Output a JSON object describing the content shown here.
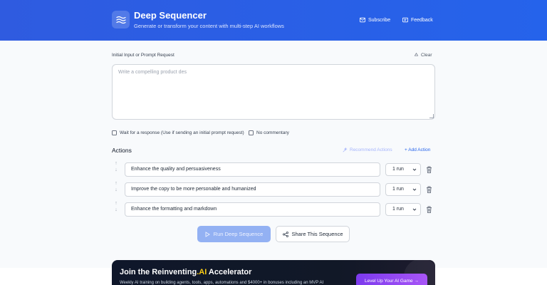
{
  "header": {
    "title": "Deep Sequencer",
    "subtitle": "Generate or transform your content with multi-step AI workflows",
    "subscribe_label": "Subscribe",
    "feedback_label": "Feedback",
    "logo_icon": "waves-icon"
  },
  "prompt": {
    "label": "Initial Input or Prompt Request",
    "clear_label": "Clear",
    "placeholder": "Write a compelling product des"
  },
  "options": {
    "wait_label": "Wait for a response (Use if sending an initial prompt request)",
    "no_commentary_label": "No commentary"
  },
  "actions": {
    "title": "Actions",
    "recommend_label": "Recommend Actions",
    "add_label": "+ Add Action",
    "items": [
      {
        "text": "Enhance the quality and persuasiveness",
        "runs": "1 run"
      },
      {
        "text": "Improve the copy to be more personable and humanized",
        "runs": "1 run"
      },
      {
        "text": "Enhance the formatting and markdown",
        "runs": "1 run"
      }
    ]
  },
  "buttons": {
    "run_label": "Run Deep Sequence",
    "share_label": "Share This Sequence"
  },
  "promo": {
    "title_prefix": "Join the Reinventing",
    "title_accent": ".AI",
    "title_suffix": " Accelerator",
    "subtitle": "Weekly AI training on building agents, tools, apps, automations and $4000+ in bonuses including an MVP AI",
    "button_label": "Level Up Your AI Game →"
  },
  "colors": {
    "header": "#2563eb",
    "accent": "#2563eb",
    "promo_bg": "#0f172a",
    "promo_button": "#7c3aed"
  }
}
